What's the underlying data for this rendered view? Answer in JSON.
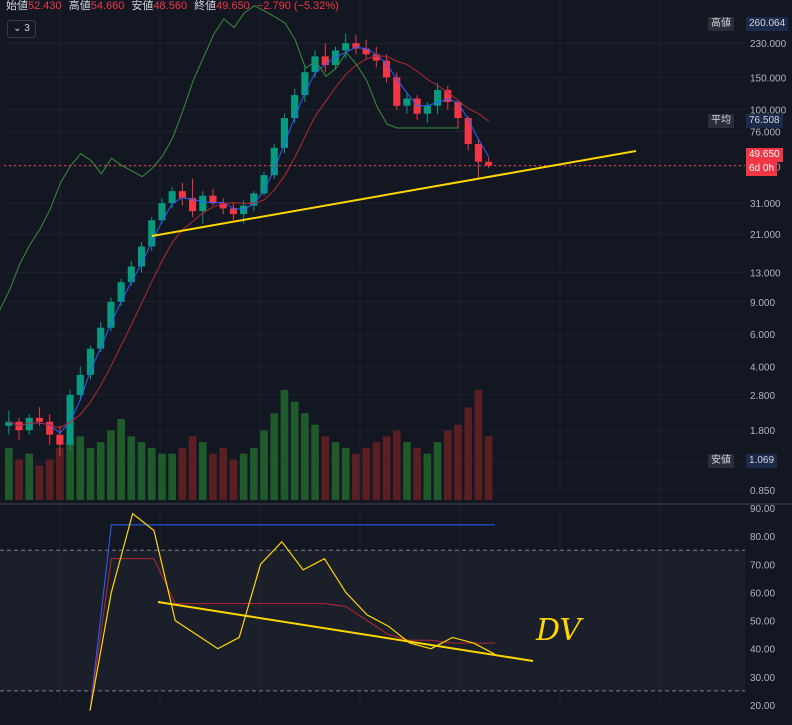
{
  "ohlc": {
    "open_label": "始値",
    "open": "52.430",
    "high_label": "高値",
    "high": "54.660",
    "low_label": "安値",
    "low": "48.560",
    "close_label": "終値",
    "close": "49.650",
    "change": "−2.790 (−5.32%)"
  },
  "toolbar": {
    "indicator_count": "3"
  },
  "price_tags": {
    "high_label": "高値",
    "high_value": "260.064",
    "avg_label": "平均",
    "avg_value": "76.508",
    "last_value": "49.650",
    "countdown": "6d 0h",
    "low_label": "安値",
    "low_value": "1.069"
  },
  "price_axis": [
    "230.000",
    "150.000",
    "100.000",
    "76.000",
    "49.000",
    "31.000",
    "21.000",
    "13.000",
    "9.000",
    "6.000",
    "4.000",
    "2.800",
    "1.800",
    "1.200",
    "0.850"
  ],
  "osc_axis": [
    "90.00",
    "80.00",
    "70.00",
    "60.00",
    "50.00",
    "40.00",
    "30.00",
    "20.00"
  ],
  "annotation": "DV",
  "colors": {
    "up": "#089981",
    "down": "#f23645",
    "volume_up": "#1e5a2a",
    "volume_down": "#5a1e23",
    "trendline": "#ffd600",
    "conversion": "#2962ff",
    "base": "#b22833",
    "span_green": "#388e3c",
    "span_light": "#a5d6a7",
    "osc_k": "#2962ff",
    "osc_d": "#b22833",
    "osc_main": "#ffd600"
  },
  "chart_data": [
    {
      "type": "candlestick",
      "y_scale": "log",
      "ylim": [
        0.75,
        300
      ],
      "candles": [
        [
          1.9,
          2.3,
          1.7,
          2.0
        ],
        [
          2.0,
          2.1,
          1.6,
          1.8
        ],
        [
          1.8,
          2.2,
          1.7,
          2.1
        ],
        [
          2.1,
          2.4,
          1.9,
          2.0
        ],
        [
          2.0,
          2.2,
          1.5,
          1.7
        ],
        [
          1.7,
          1.9,
          1.3,
          1.5
        ],
        [
          1.5,
          3.0,
          1.4,
          2.8
        ],
        [
          2.8,
          4.0,
          2.6,
          3.6
        ],
        [
          3.6,
          5.2,
          3.4,
          5.0
        ],
        [
          5.0,
          7.0,
          4.8,
          6.5
        ],
        [
          6.5,
          9.5,
          6.2,
          9.0
        ],
        [
          9.0,
          12,
          8.5,
          11.5
        ],
        [
          11.5,
          15,
          11,
          14
        ],
        [
          14,
          19,
          13,
          18
        ],
        [
          18,
          26,
          17,
          25
        ],
        [
          25,
          33,
          24,
          31
        ],
        [
          31,
          38,
          29,
          36
        ],
        [
          36,
          40,
          30,
          33
        ],
        [
          33,
          42,
          26,
          28
        ],
        [
          28,
          36,
          24,
          34
        ],
        [
          34,
          37,
          30,
          31
        ],
        [
          31,
          33,
          27,
          29
        ],
        [
          29,
          31,
          25,
          27
        ],
        [
          27,
          32,
          24,
          30
        ],
        [
          30,
          36,
          28,
          35
        ],
        [
          35,
          46,
          34,
          44
        ],
        [
          44,
          65,
          42,
          62
        ],
        [
          62,
          95,
          58,
          90
        ],
        [
          90,
          130,
          85,
          120
        ],
        [
          120,
          175,
          110,
          160
        ],
        [
          160,
          210,
          150,
          195
        ],
        [
          195,
          230,
          160,
          175
        ],
        [
          175,
          220,
          165,
          210
        ],
        [
          210,
          260,
          190,
          230
        ],
        [
          230,
          255,
          200,
          215
        ],
        [
          215,
          240,
          190,
          200
        ],
        [
          200,
          220,
          170,
          185
        ],
        [
          185,
          200,
          140,
          150
        ],
        [
          150,
          160,
          100,
          105
        ],
        [
          105,
          125,
          95,
          115
        ],
        [
          115,
          120,
          88,
          95
        ],
        [
          95,
          110,
          85,
          105
        ],
        [
          105,
          140,
          95,
          128
        ],
        [
          128,
          135,
          100,
          110
        ],
        [
          110,
          112,
          80,
          90
        ],
        [
          90,
          92,
          60,
          65
        ],
        [
          65,
          70,
          42,
          52
        ],
        [
          52,
          55,
          48,
          49.65
        ]
      ],
      "volume": [
        0.9,
        0.7,
        0.8,
        0.6,
        0.7,
        0.9,
        1.0,
        1.1,
        0.9,
        1.0,
        1.2,
        1.4,
        1.1,
        1.0,
        0.9,
        0.8,
        0.8,
        0.9,
        1.1,
        1.0,
        0.8,
        0.9,
        0.7,
        0.8,
        0.9,
        1.2,
        1.5,
        1.9,
        1.7,
        1.5,
        1.3,
        1.1,
        1.0,
        0.9,
        0.8,
        0.9,
        1.0,
        1.1,
        1.2,
        1.0,
        0.9,
        0.8,
        1.0,
        1.2,
        1.3,
        1.6,
        1.9,
        1.1
      ]
    },
    {
      "type": "line",
      "ylim": [
        20,
        90
      ],
      "series": [
        {
          "values": [
            18,
            60,
            88,
            82,
            50,
            45,
            40,
            44,
            70,
            78,
            68,
            72,
            60,
            52,
            48,
            42,
            40,
            44,
            42,
            38
          ]
        },
        {
          "values": [
            18,
            72,
            72,
            72,
            56,
            56,
            56,
            56,
            56,
            56,
            56,
            56,
            55,
            50,
            45,
            43,
            43,
            42,
            42,
            42
          ]
        },
        {
          "values": [
            18,
            84,
            84,
            84,
            84,
            84,
            84,
            84,
            84,
            84,
            84,
            84,
            84,
            84,
            84,
            84,
            84,
            84,
            84,
            84
          ]
        }
      ]
    }
  ]
}
